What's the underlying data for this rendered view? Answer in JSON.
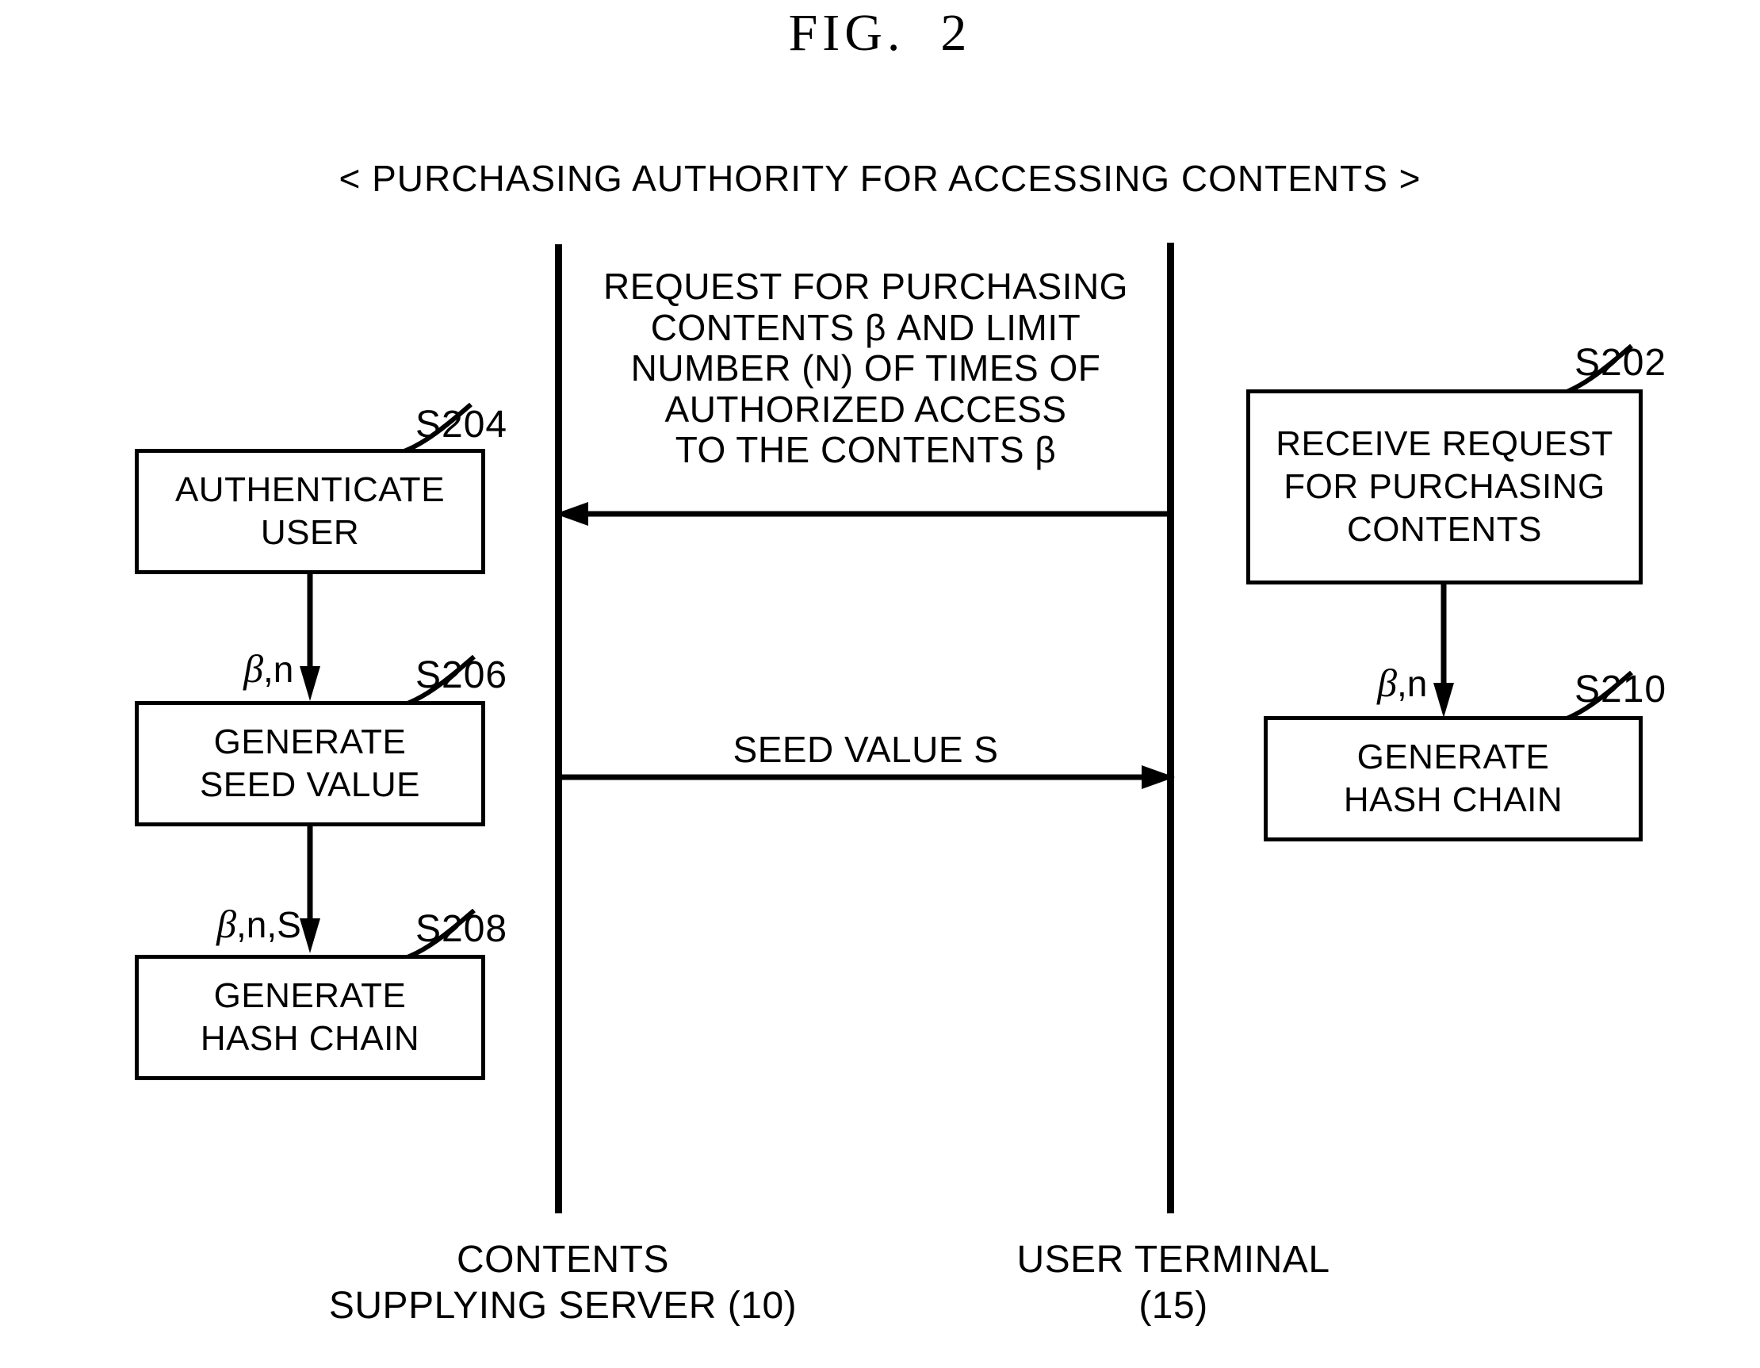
{
  "figure": {
    "title": "FIG.  2",
    "subtitle": "< PURCHASING AUTHORITY FOR ACCESSING CONTENTS >"
  },
  "actors": [
    {
      "id": "server",
      "caption": "CONTENTS\nSUPPLYING SERVER (10)"
    },
    {
      "id": "terminal",
      "caption": "USER TERMINAL\n(15)"
    }
  ],
  "messages": [
    {
      "id": "purchase-request",
      "text": "REQUEST FOR PURCHASING\nCONTENTS β AND LIMIT\nNUMBER (N) OF TIMES OF\nAUTHORIZED ACCESS\nTO THE CONTENTS β",
      "direction": "right-to-left"
    },
    {
      "id": "seed-value",
      "text": "SEED VALUE S",
      "direction": "left-to-right"
    }
  ],
  "steps": {
    "s202": {
      "ref": "S202",
      "label": "RECEIVE REQUEST\nFOR PURCHASING\nCONTENTS"
    },
    "s204": {
      "ref": "S204",
      "label": "AUTHENTICATE\nUSER"
    },
    "s206": {
      "ref": "S206",
      "label": "GENERATE\nSEED VALUE"
    },
    "s208": {
      "ref": "S208",
      "label": "GENERATE\nHASH CHAIN"
    },
    "s210": {
      "ref": "S210",
      "label": "GENERATE\nHASH CHAIN"
    }
  },
  "flow_labels": {
    "server_s204_to_s206": {
      "beta": "β",
      "rest": ",n"
    },
    "server_s206_to_s208": {
      "beta": "β",
      "rest": ",n,S"
    },
    "terminal_s202_to_s210": {
      "beta": "β",
      "rest": ",n"
    }
  },
  "colors": {
    "ink": "#000000",
    "paper": "#ffffff"
  }
}
